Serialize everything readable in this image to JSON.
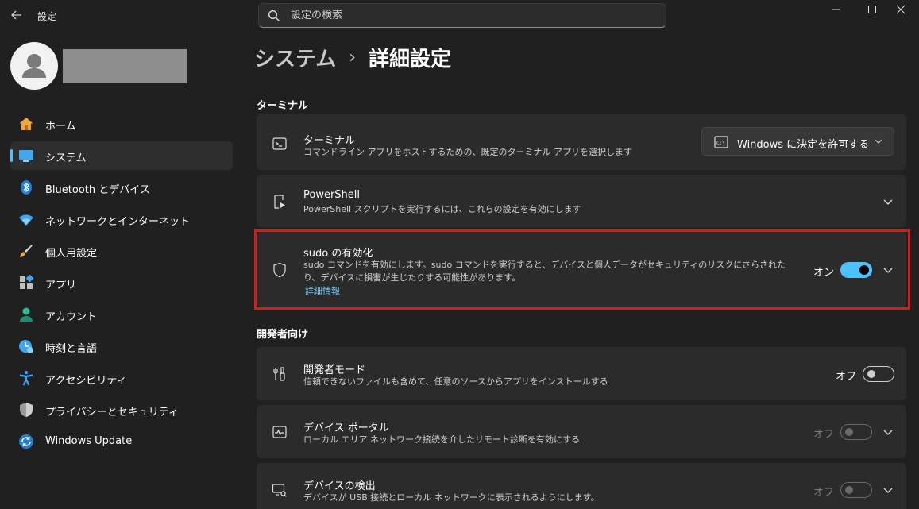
{
  "window": {
    "app_title": "設定",
    "search_placeholder": "設定の検索"
  },
  "sidebar": {
    "items": [
      {
        "label": "ホーム",
        "icon": "home-icon"
      },
      {
        "label": "システム",
        "icon": "system-icon",
        "selected": true
      },
      {
        "label": "Bluetooth とデバイス",
        "icon": "bluetooth-icon"
      },
      {
        "label": "ネットワークとインターネット",
        "icon": "wifi-icon"
      },
      {
        "label": "個人用設定",
        "icon": "brush-icon"
      },
      {
        "label": "アプリ",
        "icon": "apps-icon"
      },
      {
        "label": "アカウント",
        "icon": "account-icon"
      },
      {
        "label": "時刻と言語",
        "icon": "time-language-icon"
      },
      {
        "label": "アクセシビリティ",
        "icon": "accessibility-icon"
      },
      {
        "label": "プライバシーとセキュリティ",
        "icon": "shield-icon"
      },
      {
        "label": "Windows Update",
        "icon": "update-icon"
      }
    ]
  },
  "main": {
    "breadcrumb_parent": "システム",
    "breadcrumb_separator": "›",
    "breadcrumb_current": "詳細設定",
    "section_terminal": "ターミナル",
    "section_developer": "開発者向け",
    "terminal": {
      "title": "ターミナル",
      "desc": "コマンドライン アプリをホストするための、既定のターミナル アプリを選択します",
      "dropdown_value": "Windows に決定を許可する"
    },
    "powershell": {
      "title": "PowerShell",
      "desc": "PowerShell スクリプトを実行するには、これらの設定を有効にします"
    },
    "sudo": {
      "title": "sudo の有効化",
      "desc": "sudo コマンドを有効にします。sudo コマンドを実行すると、デバイスと個人データがセキュリティのリスクにさらされたり、デバイスに損害が生じたりする可能性があります。",
      "link": "詳細情報",
      "toggle_label": "オン",
      "toggle_on": true
    },
    "dev_mode": {
      "title": "開発者モード",
      "desc": "信頼できないファイルも含めて、任意のソースからアプリをインストールする",
      "toggle_label": "オフ",
      "toggle_on": false
    },
    "device_portal": {
      "title": "デバイス ポータル",
      "desc": "ローカル エリア ネットワーク接続を介したリモート診断を有効にする",
      "toggle_label": "オフ",
      "toggle_on": false
    },
    "device_discovery": {
      "title": "デバイスの検出",
      "desc": "デバイスが USB 接続とローカル ネットワークに表示されるようにします。",
      "toggle_label": "オフ",
      "toggle_on": false
    }
  },
  "colors": {
    "accent": "#4cc2ff",
    "highlight": "#e0161b",
    "background": "#202020",
    "card": "#2b2b2b"
  }
}
